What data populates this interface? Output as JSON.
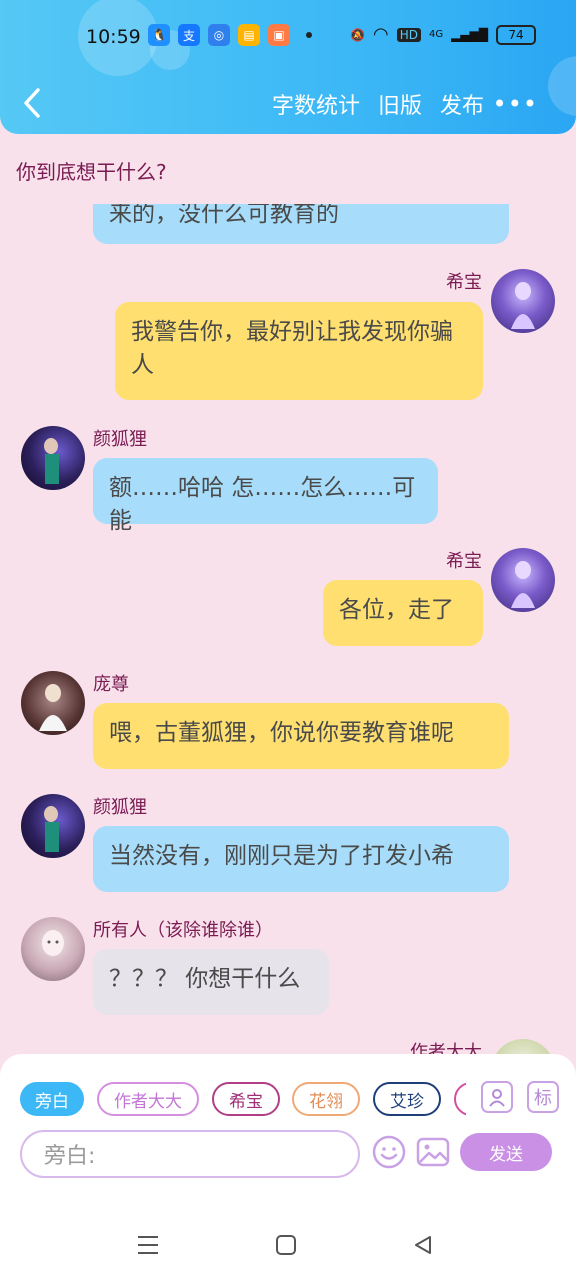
{
  "status_bar": {
    "time": "10:59",
    "network": "4G",
    "hd": "HD",
    "battery": "74"
  },
  "header": {
    "actions": [
      "字数统计",
      "旧版",
      "发布"
    ],
    "more": "•••"
  },
  "question": "你到底想干什么?",
  "messages": [
    {
      "speaker": "",
      "text": "来的，没什么可教育的",
      "side": "left",
      "color": "blue"
    },
    {
      "speaker": "希宝",
      "text": "我警告你，最好别让我发现你骗人",
      "side": "right",
      "color": "yellow"
    },
    {
      "speaker": "颜狐狸",
      "text": "额……哈哈 怎……怎么……可能",
      "side": "left",
      "color": "blue"
    },
    {
      "speaker": "希宝",
      "text": "各位，走了",
      "side": "right",
      "color": "yellow"
    },
    {
      "speaker": "庞尊",
      "text": "喂，古董狐狸，你说你要教育谁呢",
      "side": "left",
      "color": "yellow"
    },
    {
      "speaker": "颜狐狸",
      "text": "当然没有，刚刚只是为了打发小希",
      "side": "left",
      "color": "blue"
    },
    {
      "speaker": "所有人（该除谁除谁）",
      "text": "？？？ 你想干什么",
      "side": "left",
      "color": "gray"
    },
    {
      "speaker": "作者大大",
      "text": "",
      "side": "right",
      "color": "yellow"
    }
  ],
  "composer": {
    "roles": [
      "旁白",
      "作者大大",
      "希宝",
      "花翎",
      "艾珍"
    ],
    "active_role": "旁白",
    "input_value": "旁白:",
    "tag_label": "标",
    "send_label": "发送"
  },
  "colors": {
    "header": "#3cb8f6",
    "chat_bg": "#f9e1ec",
    "bubble_blue": "#a7ddfa",
    "bubble_yellow": "#fedf70",
    "bubble_gray": "#e6e3ea",
    "name": "#7a1c52",
    "accent": "#c990e6"
  }
}
